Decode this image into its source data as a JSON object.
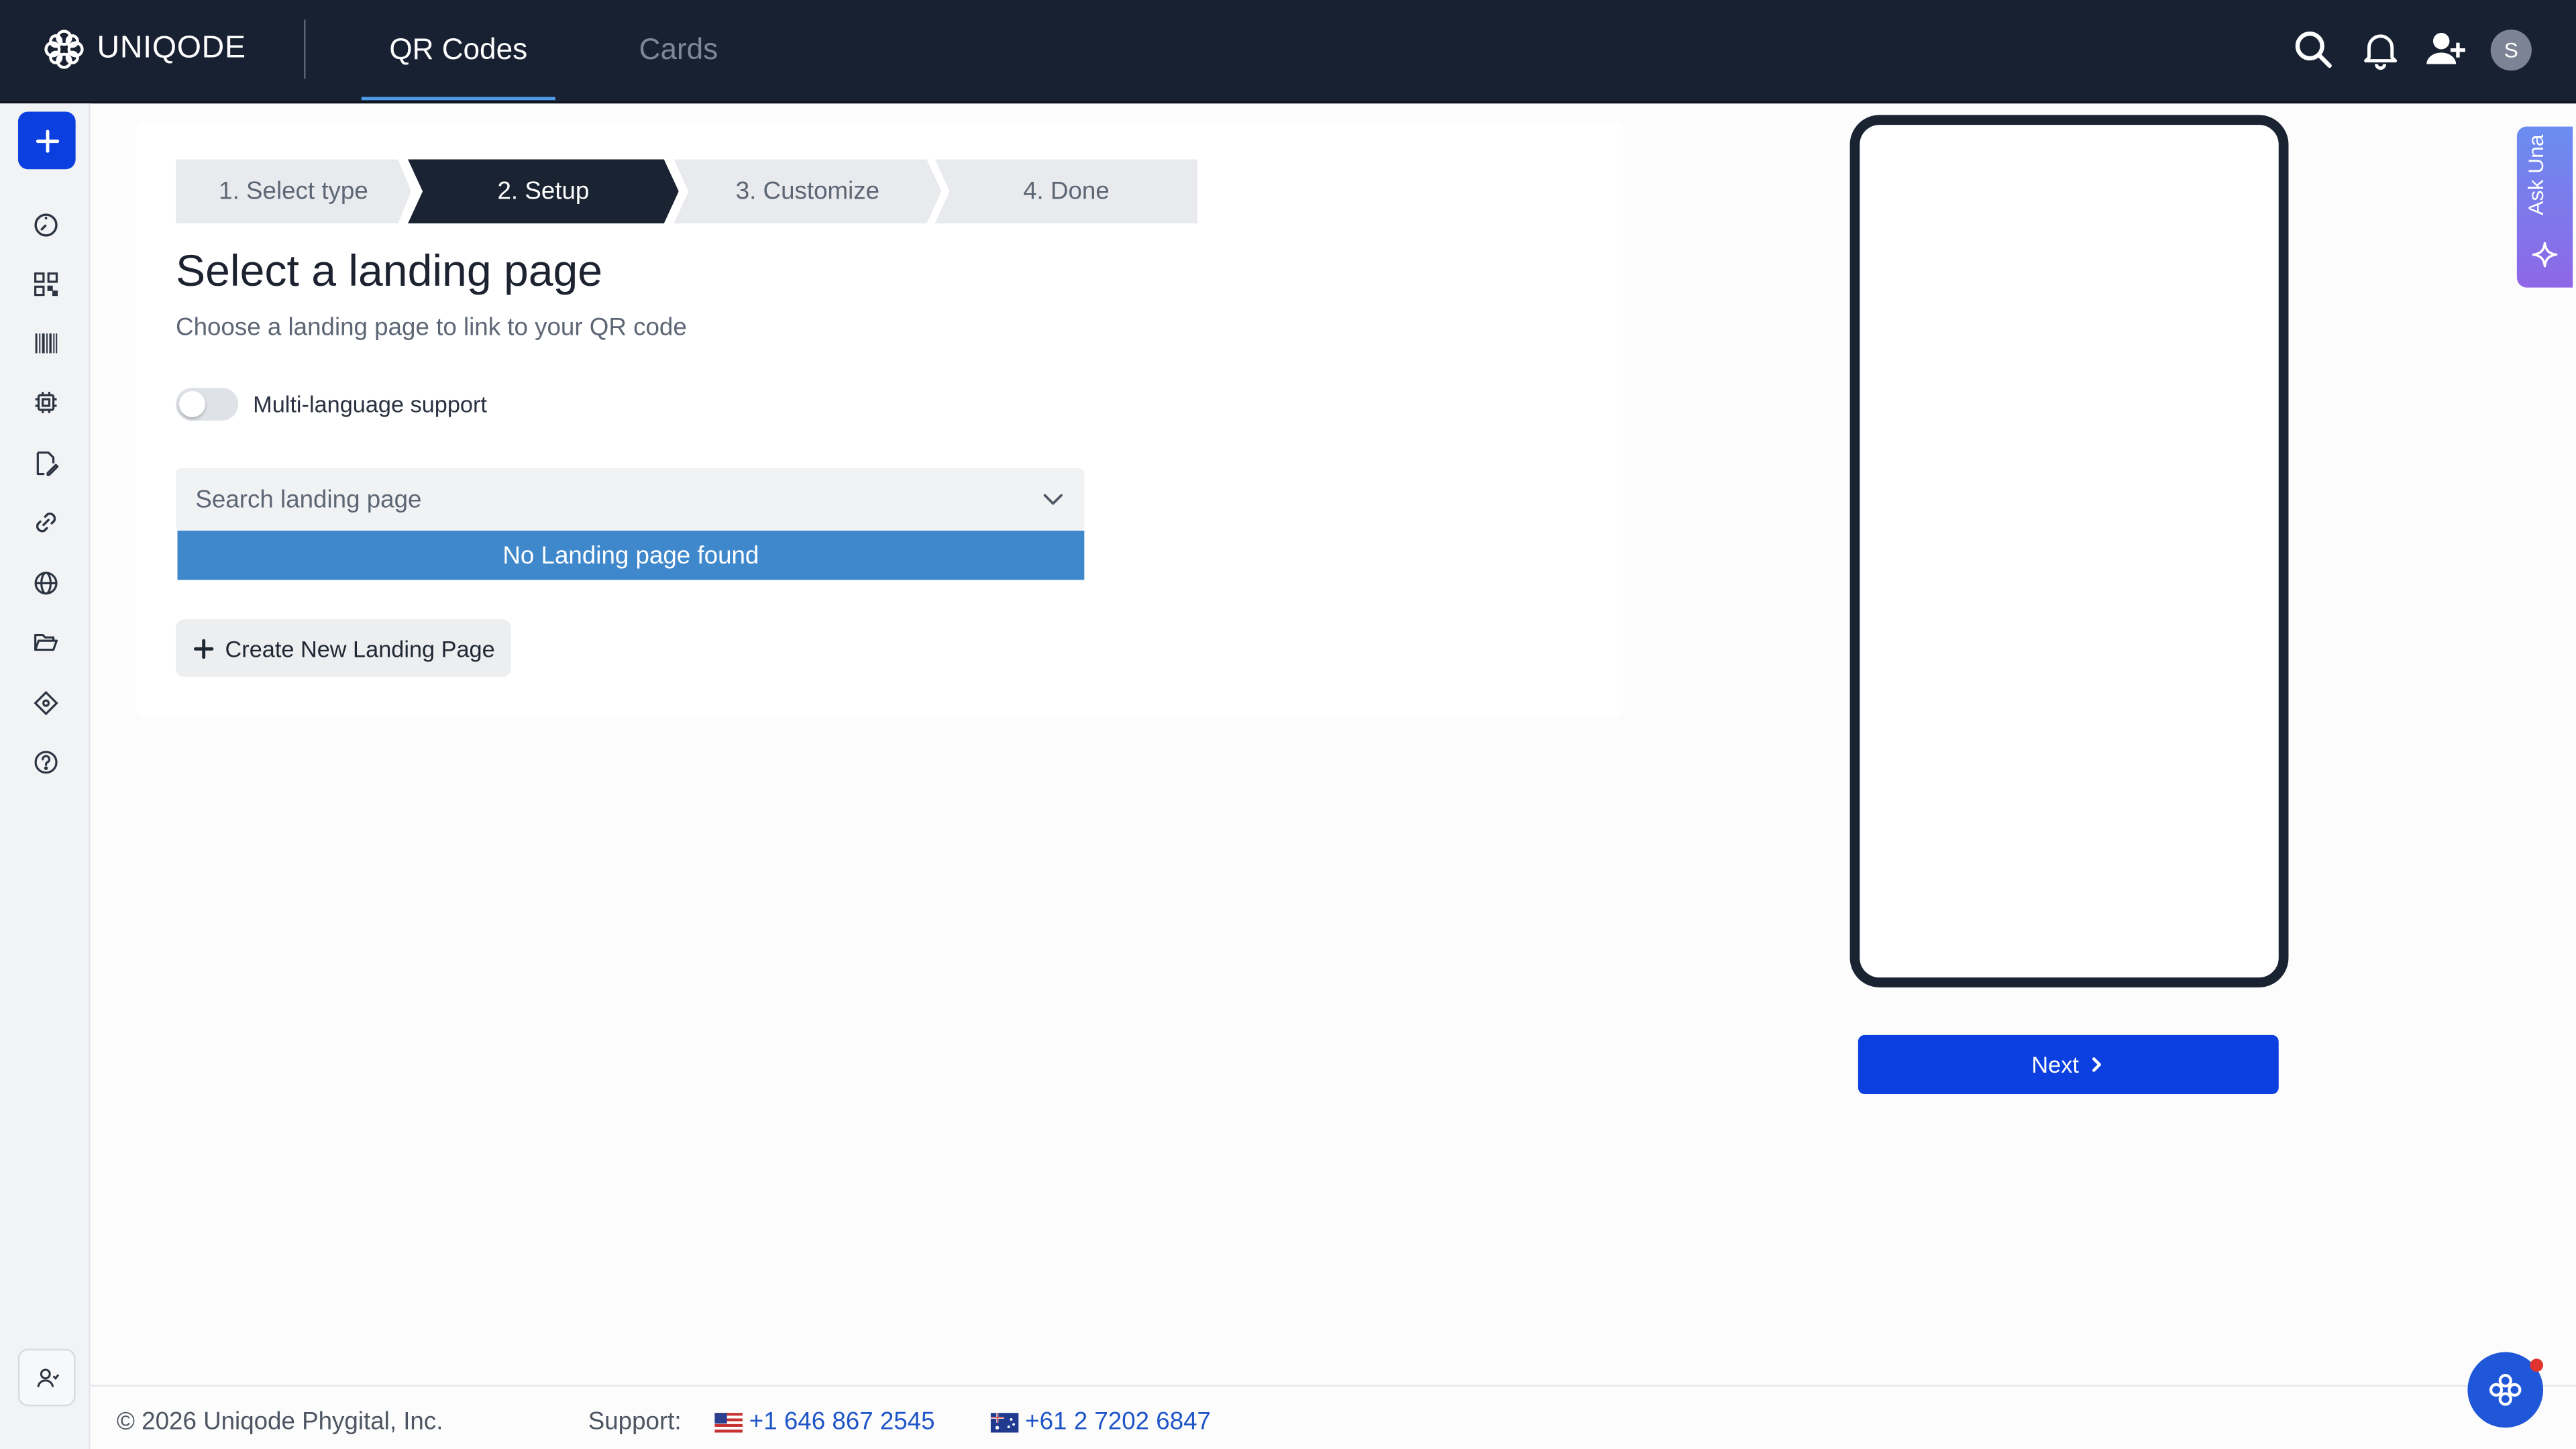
{
  "app": {
    "brand": "UNIQODE"
  },
  "header": {
    "tabs": [
      {
        "label": "QR Codes",
        "active": true
      },
      {
        "label": "Cards",
        "active": false
      }
    ],
    "avatar_initial": "S",
    "icons": [
      "search-icon",
      "bell-icon",
      "add-user-icon"
    ]
  },
  "sidebar": {
    "create_icon": "plus-icon",
    "items": [
      {
        "icon": "dashboard-icon"
      },
      {
        "icon": "qr-code-icon"
      },
      {
        "icon": "barcode-icon"
      },
      {
        "icon": "chip-icon"
      },
      {
        "icon": "edit-document-icon"
      },
      {
        "icon": "link-icon"
      },
      {
        "icon": "globe-icon"
      },
      {
        "icon": "folder-icon"
      },
      {
        "icon": "integrations-icon"
      },
      {
        "icon": "help-icon"
      }
    ],
    "bottom_icon": "user-settings-icon"
  },
  "wizard": {
    "steps": [
      {
        "label": "1. Select type",
        "active": false
      },
      {
        "label": "2. Setup",
        "active": true
      },
      {
        "label": "3. Customize",
        "active": false
      },
      {
        "label": "4. Done",
        "active": false
      }
    ]
  },
  "main": {
    "title": "Select a landing page",
    "subtitle": "Choose a landing page to link to your QR code",
    "multilang_label": "Multi-language support",
    "multilang_enabled": false,
    "search_placeholder": "Search landing page",
    "no_results": "No Landing page found",
    "create_button": "Create New Landing Page"
  },
  "preview": {
    "next_button": "Next"
  },
  "ask_una": {
    "label": "Ask Una"
  },
  "footer": {
    "copyright": "© 2026 Uniqode Phygital, Inc.",
    "support_label": "Support:",
    "phones": [
      {
        "flag": "us-flag",
        "number": "+1 646 867 2545"
      },
      {
        "flag": "au-flag",
        "number": "+61 2 7202 6847"
      }
    ]
  },
  "colors": {
    "topbar": "#172132",
    "primary": "#0c3fe0",
    "active_step": "#1a2332",
    "dropdown_highlight": "#3f88cc",
    "link": "#1f55c7"
  }
}
